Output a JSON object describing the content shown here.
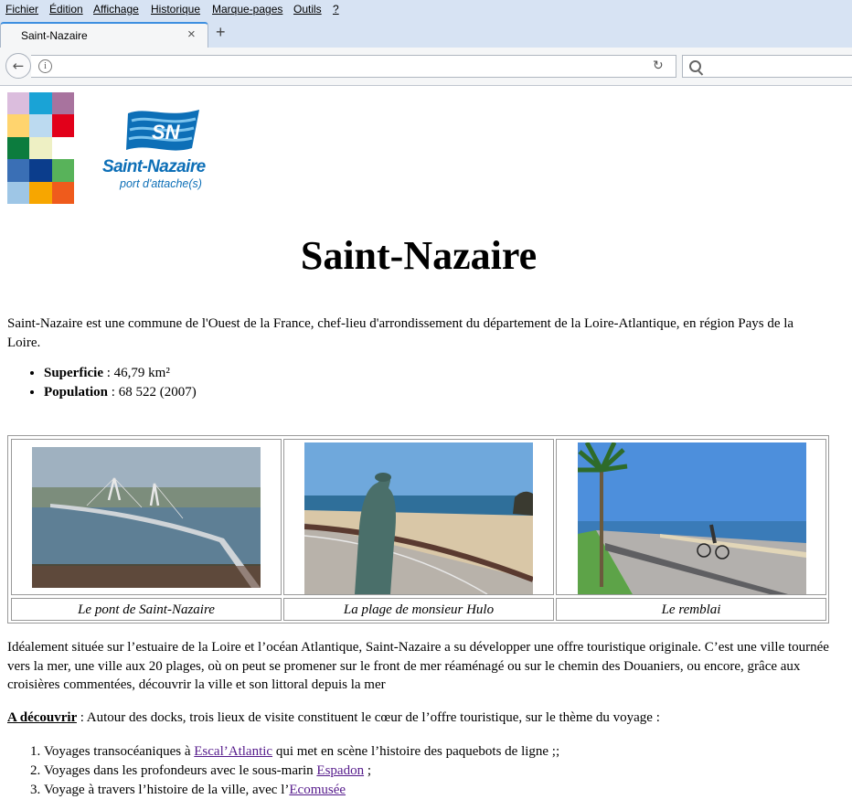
{
  "menubar": {
    "items": [
      "Fichier",
      "Édition",
      "Affichage",
      "Historique",
      "Marque-pages",
      "Outils",
      "?"
    ]
  },
  "tab": {
    "title": "Saint-Nazaire",
    "close": "×",
    "new_tab": "+"
  },
  "navbar": {
    "url_value": "",
    "search_value": ""
  },
  "logo": {
    "name": "Saint-Nazaire",
    "tagline": "port d'attache(s)",
    "flag_text": "SN"
  },
  "page": {
    "title": "Saint-Nazaire",
    "intro": "Saint-Nazaire est une commune de l'Ouest de la France, chef-lieu d'arrondissement du département de la Loire-Atlantique, en région Pays de la Loire.",
    "facts": [
      {
        "label": "Superficie",
        "value": " : 46,79 km²"
      },
      {
        "label": "Population",
        "value": " : 68 522 (2007)"
      }
    ],
    "photos": [
      {
        "caption": "Le pont de Saint-Nazaire"
      },
      {
        "caption": "La plage de monsieur Hulo"
      },
      {
        "caption": "Le remblai"
      }
    ],
    "description": "Idéalement située sur l’estuaire de la Loire et l’océan Atlantique, Saint-Nazaire a su développer une offre touristique originale. C’est une ville tournée vers la mer, une ville aux 20 plages, où on peut se promener sur le front de mer réaménagé ou sur le chemin des Douaniers, ou encore, grâce aux croisières commentées, découvrir la ville et son littoral depuis la mer",
    "discover_label": "A découvrir",
    "discover_text": " : Autour des docks, trois lieux de visite constituent le cœur de l’offre touristique, sur le thème du voyage :",
    "visits": [
      {
        "before": "Voyages transocéaniques à ",
        "link": "Escal’Atlantic",
        "after": " qui met en scène l’histoire des paquebots de ligne ;;"
      },
      {
        "before": "Voyages dans les profondeurs avec le sous-marin ",
        "link": "Espadon",
        "after": " ;"
      },
      {
        "before": "Voyage à travers l’histoire de la ville, avec l’",
        "link": "Ecomusée",
        "after": ""
      }
    ]
  },
  "colors": {
    "logo_blue": "#0d6fb7",
    "visited_link": "#551a8b",
    "mosaic": [
      "#dbbddd",
      "#1aa3d6",
      "#a8739e",
      "#ffd46e",
      "#bcdaf0",
      "#e2001a",
      "#0c7c3e",
      "#eef0c4",
      "#ffffff",
      "#3a6fb5",
      "#0b3d8c",
      "#58b35a",
      "#9ec6e6",
      "#f7a600",
      "#ef5b1c"
    ]
  }
}
